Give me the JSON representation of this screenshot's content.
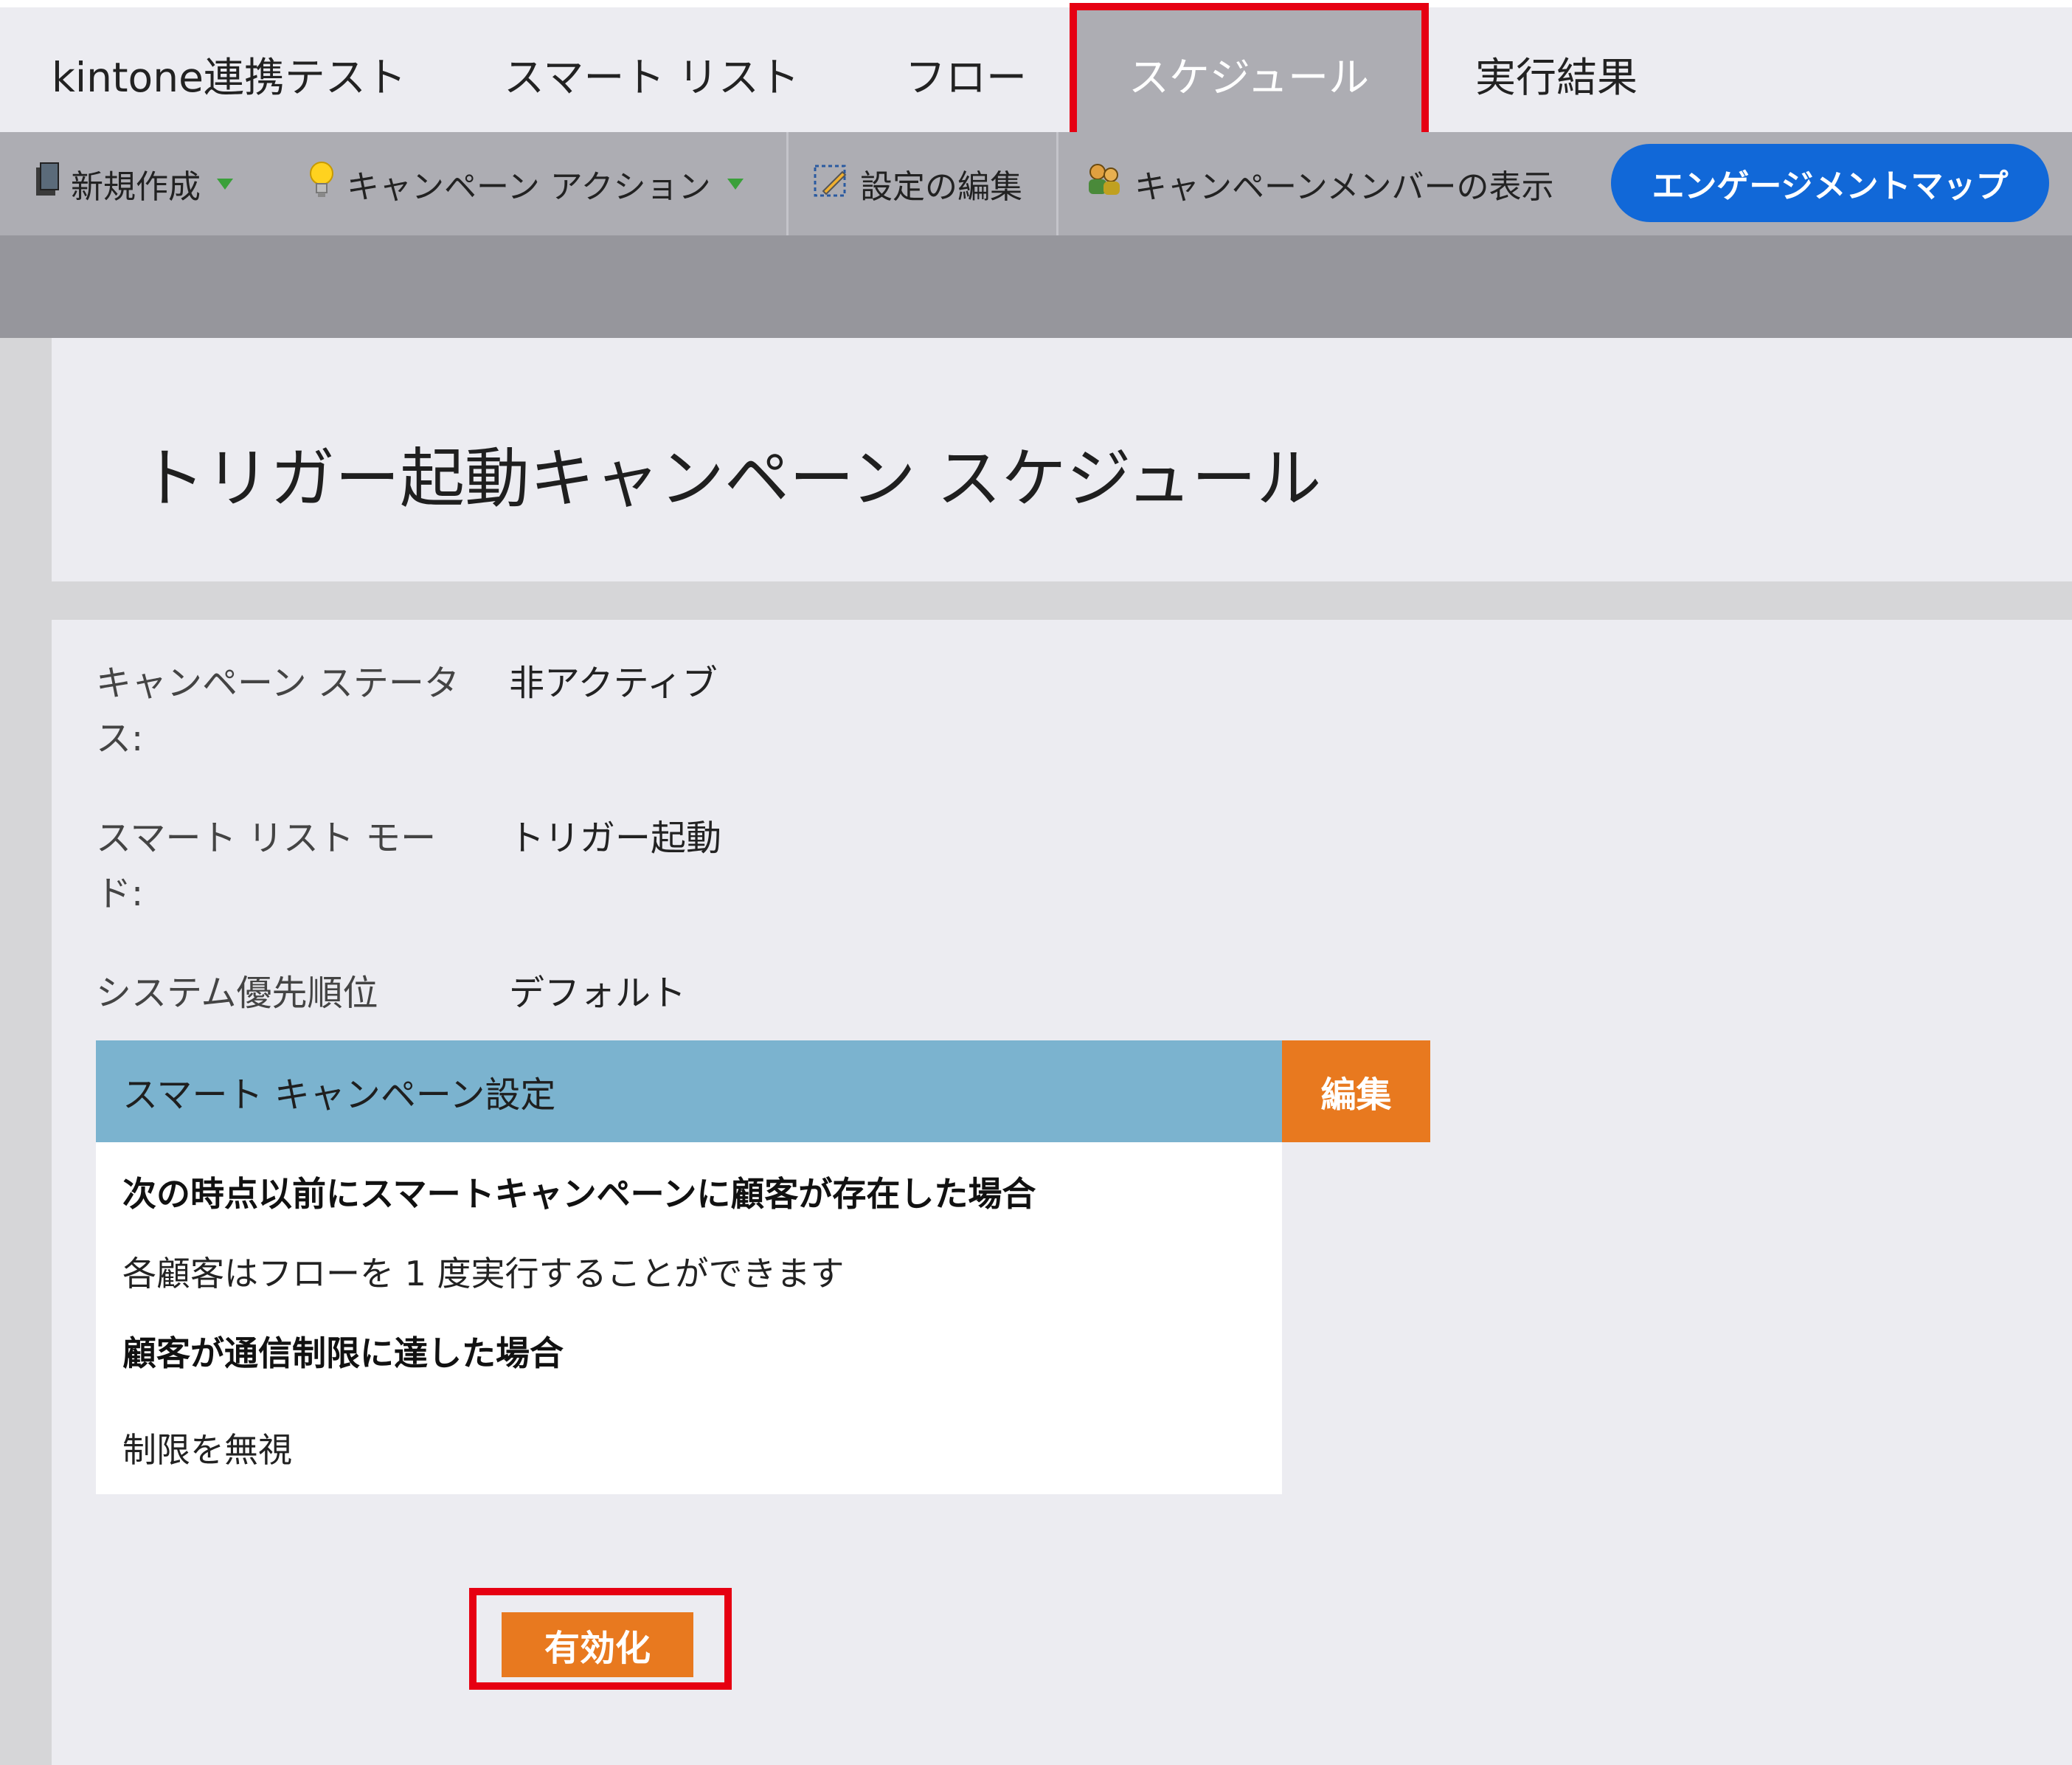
{
  "tabs": [
    {
      "label": "kintone連携テスト"
    },
    {
      "label": "スマート リスト"
    },
    {
      "label": "フロー"
    },
    {
      "label": "スケジュール",
      "active": true
    },
    {
      "label": "実行結果"
    }
  ],
  "toolbar": {
    "new_label": "新規作成",
    "campaign_action_label": "キャンペーン アクション",
    "edit_settings_label": "設定の編集",
    "view_members_label": "キャンペーンメンバーの表示",
    "engagement_map_label": "エンゲージメントマップ"
  },
  "page": {
    "title": "トリガー起動キャンペーン スケジュール"
  },
  "details": [
    {
      "label": "キャンペーン ステータス:",
      "value": "非アクティブ"
    },
    {
      "label": "スマート リスト モード:",
      "value": "トリガー起動"
    },
    {
      "label": "システム優先順位",
      "value": "デフォルト"
    }
  ],
  "smart_campaign": {
    "header": "スマート キャンペーン設定",
    "edit_label": "編集",
    "lines": [
      {
        "text": "次の時点以前にスマートキャンペーンに顧客が存在した場合",
        "bold": true
      },
      {
        "text": "各顧客はフローを 1 度実行することができます",
        "bold": false
      },
      {
        "text": "顧客が通信制限に達した場合",
        "bold": true
      },
      {
        "text": "制限を無視",
        "bold": false
      }
    ]
  },
  "activate_label": "有効化",
  "colors": {
    "highlight": "#e60012",
    "accent_orange": "#e8791f",
    "primary_blue": "#1168d8",
    "panel_blue": "#7bb3cf"
  }
}
